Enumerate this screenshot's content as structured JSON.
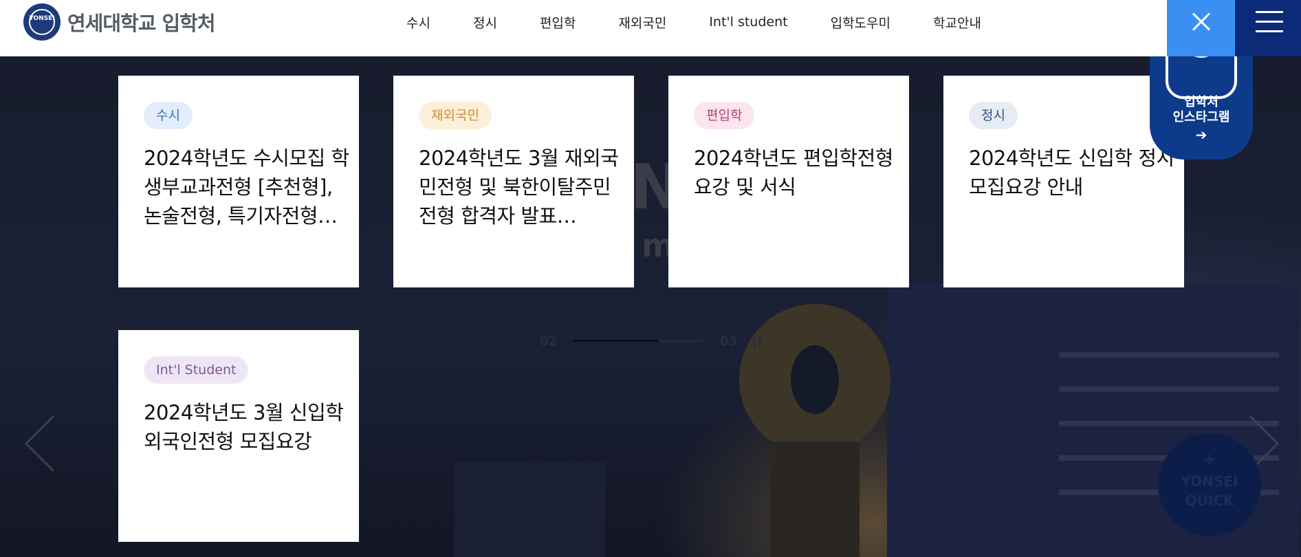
{
  "header": {
    "logo_emblem": "YONSEI",
    "logo_text": "연세대학교 입학처",
    "nav": [
      "수시",
      "정시",
      "편입학",
      "재외국민",
      "Int'l student",
      "입학도우미",
      "학교안내"
    ]
  },
  "instagram": {
    "line1": "입학처",
    "line2": "인스타그램",
    "arrow": "➔"
  },
  "cards": [
    {
      "badge": "수시",
      "badge_color": "#3b6fb5",
      "badge_bg": "#e3edfb",
      "title": "2024학년도 수시모집 학생부교과전형 [추천형], 논술전형, 특기자전형…"
    },
    {
      "badge": "재외국민",
      "badge_color": "#d08b2c",
      "badge_bg": "#fdf0da",
      "title": "2024학년도 3월 재외국민전형 및 북한이탈주민전형 합격자 발표…"
    },
    {
      "badge": "편입학",
      "badge_color": "#b2436f",
      "badge_bg": "#fbe5ee",
      "title": "2024학년도 편입학전형 요강 및 서식"
    },
    {
      "badge": "정시",
      "badge_color": "#3a4f78",
      "badge_bg": "#e6ebf4",
      "title": "2024학년도 신입학 정시모집요강 안내"
    },
    {
      "badge": "Int'l Student",
      "badge_color": "#7a5a92",
      "badge_bg": "#efe6f5",
      "title": "2024학년도 3월 신입학 외국인전형 모집요강"
    }
  ],
  "slider": {
    "current": "02",
    "next": "03",
    "progress": 0.66
  },
  "quick": {
    "plus": "+",
    "line1": "YONSEI",
    "line2": "QUICK"
  },
  "hero_ghost": {
    "big": "N",
    "small": "m"
  }
}
